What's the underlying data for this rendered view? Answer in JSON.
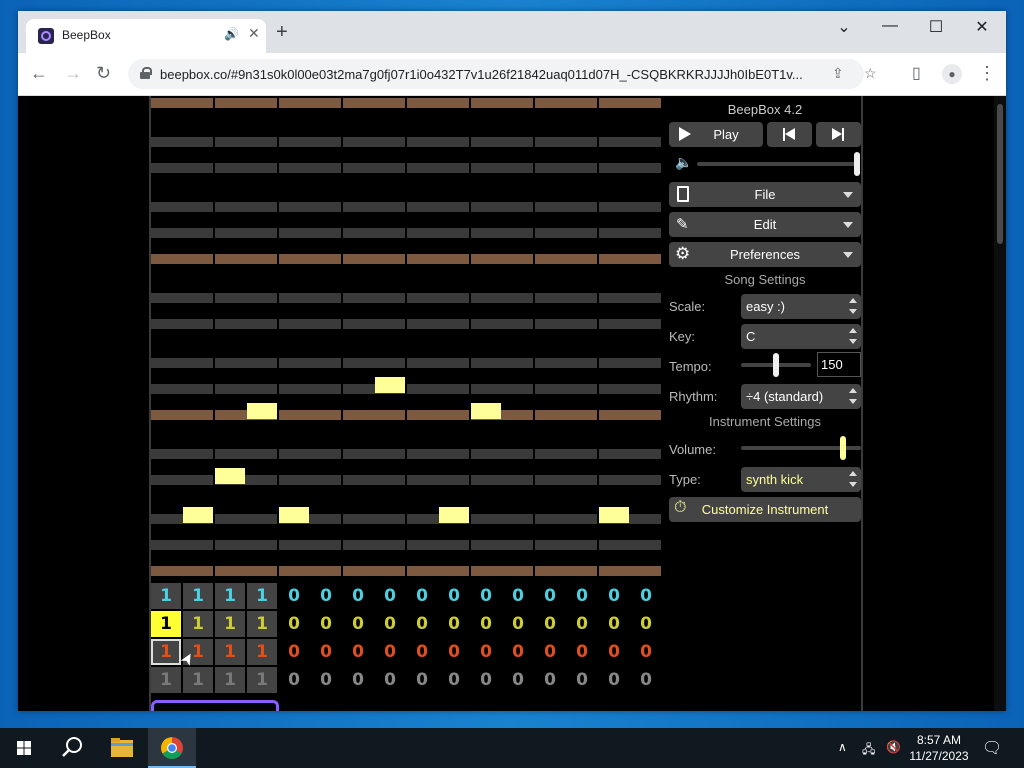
{
  "browser": {
    "tab_title": "BeepBox",
    "url": "beepbox.co/#9n31s0k0l00e03t2ma7g0fj07r1i0o432T7v1u26f21842uaq011d07H_-CSQBKRKRJJJJh0IbE0T1v..."
  },
  "app": {
    "version_title": "BeepBox 4.2",
    "play_label": "Play",
    "file_label": "File",
    "edit_label": "Edit",
    "preferences_label": "Preferences",
    "master_volume": 1.0,
    "song_settings_title": "Song Settings",
    "scale_label": "Scale:",
    "scale_value": "easy :)",
    "key_label": "Key:",
    "key_value": "C",
    "tempo_label": "Tempo:",
    "tempo_value": "150",
    "rhythm_label": "Rhythm:",
    "rhythm_value": "÷4 (standard)",
    "instrument_settings_title": "Instrument Settings",
    "volume_label": "Volume:",
    "type_label": "Type:",
    "type_value": "synth kick",
    "customize_label": "Customize Instrument"
  },
  "pattern_rows": [
    {
      "color": "#4dd0e1",
      "cells": [
        "1",
        "1",
        "1",
        "1",
        "0",
        "0",
        "0",
        "0",
        "0",
        "0",
        "0",
        "0",
        "0",
        "0",
        "0",
        "0"
      ]
    },
    {
      "color": "#cccc33",
      "cells": [
        "1",
        "1",
        "1",
        "1",
        "0",
        "0",
        "0",
        "0",
        "0",
        "0",
        "0",
        "0",
        "0",
        "0",
        "0",
        "0"
      ]
    },
    {
      "color": "#e0501c",
      "cells": [
        "1",
        "1",
        "1",
        "1",
        "0",
        "0",
        "0",
        "0",
        "0",
        "0",
        "0",
        "0",
        "0",
        "0",
        "0",
        "0"
      ]
    },
    {
      "color": "#888888",
      "cells": [
        "1",
        "1",
        "1",
        "1",
        "0",
        "0",
        "0",
        "0",
        "0",
        "0",
        "0",
        "0",
        "0",
        "0",
        "0",
        "0"
      ]
    }
  ],
  "taskbar": {
    "time": "8:57 AM",
    "date": "11/27/2023"
  }
}
